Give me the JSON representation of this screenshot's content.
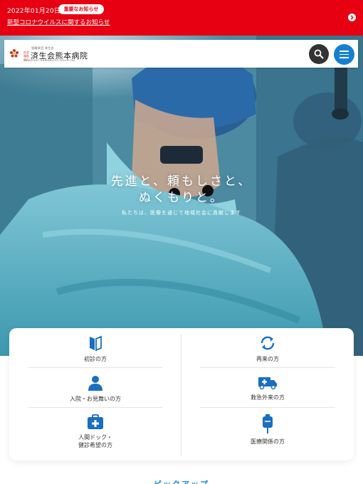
{
  "alert": {
    "date": "2022年01月20日",
    "badge": "重要なお知らせ",
    "link": "新型コロナウイルスに関するお知らせ"
  },
  "header": {
    "logo_small": "恩賜財団 済生会",
    "logo_tag": "社会福祉法人",
    "logo_name": "済生会熊本病院",
    "logo_en": "SAISEIKAI KUMAMOTO HOSPITAL"
  },
  "hero": {
    "catch_line1": "先進と、頼もしさと、",
    "catch_line2": "ぬくもりと。",
    "sub": "私たちは、医療を通じて地域社会に貢献します"
  },
  "visitor": {
    "first_visit": "初診の方",
    "return_visit": "再来の方",
    "inpatient": "入院・お見舞いの方",
    "emergency": "救急外来の方",
    "dock_line1": "人間ドック・",
    "dock_line2": "健診希望の方",
    "medical": "医療関係の方"
  },
  "pickup_title": "ピックアップ",
  "colors": {
    "alert_red": "#e60012",
    "brand_blue": "#1481d0",
    "icon_blue": "#1a6fc0"
  },
  "icons": [
    "arrow-right-icon",
    "search-icon",
    "menu-icon",
    "book-icon",
    "refresh-icon",
    "person-icon",
    "ambulance-icon",
    "first-aid-kit-icon",
    "iv-drip-icon"
  ]
}
